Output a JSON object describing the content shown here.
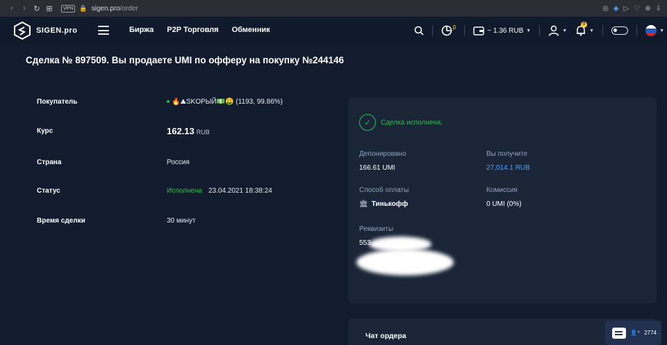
{
  "browser": {
    "back": "‹",
    "forward": "›",
    "reload": "↻",
    "grid": "⊞",
    "vpn": "VPN",
    "lock": "🔒",
    "url_host": "sigen.pro",
    "url_path": "/order",
    "right_icons": [
      "◎",
      "◆",
      "▷",
      "♡",
      "⊕",
      "⇩"
    ]
  },
  "header": {
    "logo_text": "SIGEN.pro",
    "menu": [
      "Биржа",
      "P2P Торговля",
      "Обменник"
    ],
    "beta": "β",
    "balance": "~ 1.36 RUB",
    "notifications_count": "0"
  },
  "page": {
    "title": "Сделка № 897509. Вы продаете UMI по офферу на покупку №244146"
  },
  "details": {
    "buyer_label": "Покупатель",
    "buyer_value": "🔥⛰SKOРЫЙ💵🤑 (1193, 99.86%)",
    "rate_label": "Курс",
    "rate_value": "162.13",
    "rate_unit": "RUB",
    "country_label": "Страна",
    "country_value": "Россия",
    "status_label": "Статус",
    "status_value": "Исполнена",
    "status_time": "23.04.2021 18:38:24",
    "deal_time_label": "Время сделки",
    "deal_time_value": "30 минут"
  },
  "deal_card": {
    "done_text": "Сделка исполнена.",
    "deposited_label": "Депонировано",
    "deposited_value": "166.61 UMI",
    "receive_label": "Вы получите",
    "receive_value": "27,014.1 RUB",
    "payment_label": "Способ оплаты",
    "payment_value": "Тинькофф",
    "fee_label": "Комиссия",
    "fee_value": "0 UMI (0%)",
    "requisites_label": "Реквизиты",
    "requisites_visible": "553"
  },
  "chat": {
    "title": "Чат ордера",
    "online_count": "2774"
  },
  "colors": {
    "background": "#131c2e",
    "card": "#1b2538",
    "success": "#27c24c",
    "link": "#4aa3ff",
    "label": "#8ea3c4",
    "beta": "#f2c94c"
  }
}
